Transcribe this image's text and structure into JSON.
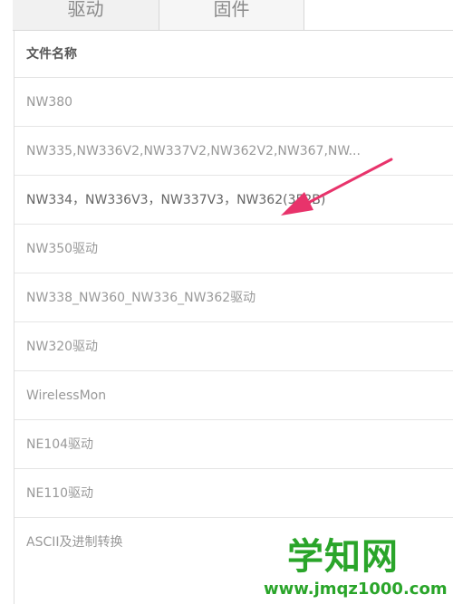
{
  "tabs": {
    "driver": "驱动",
    "firmware": "固件"
  },
  "table": {
    "header": "文件名称",
    "rows": [
      "NW380",
      "NW335,NW336V2,NW337V2,NW362V2,NW367,NW...",
      "NW334，NW336V3，NW337V3，NW362(352B)",
      "NW350驱动",
      "NW338_NW360_NW336_NW362驱动",
      "NW320驱动",
      "WirelessMon",
      "NE104驱动",
      "NE110驱动",
      "ASCII及进制转换"
    ]
  },
  "annotation": {
    "arrow_color": "#e8336b"
  },
  "watermark": {
    "title": "学知网",
    "url": "www.jmqz1000.com",
    "color": "#2aa52a"
  }
}
